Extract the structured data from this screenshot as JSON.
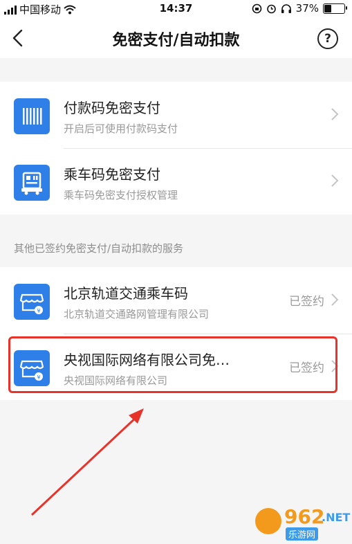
{
  "status_bar": {
    "carrier": "中国移动",
    "time": "14:37",
    "battery": "37%",
    "battery_level": 0.37
  },
  "nav": {
    "title": "免密支付/自动扣款",
    "help": "?"
  },
  "primary_items": [
    {
      "title": "付款码免密支付",
      "subtitle": "开启后可使用付款码支付",
      "icon": "barcode-icon"
    },
    {
      "title": "乘车码免密支付",
      "subtitle": "乘车码免密支付授权管理",
      "icon": "bus-qr-icon"
    }
  ],
  "section_label": "其他已签约免密支付/自动扣款的服务",
  "signed_items": [
    {
      "title": "北京轨道交通乘车码",
      "subtitle": "北京轨道交通路网管理有限公司",
      "status": "已签约",
      "icon": "store-icon"
    },
    {
      "title": "央视国际网络有限公司免…",
      "subtitle": "央视国际网络有限公司",
      "status": "已签约",
      "icon": "store-icon"
    }
  ],
  "watermark": {
    "number": "962",
    "suffix": ".NET",
    "sub": "乐游网"
  },
  "colors": {
    "accent": "#2f7fe8",
    "highlight": "#e8332b",
    "arrow": "#e8332b"
  }
}
